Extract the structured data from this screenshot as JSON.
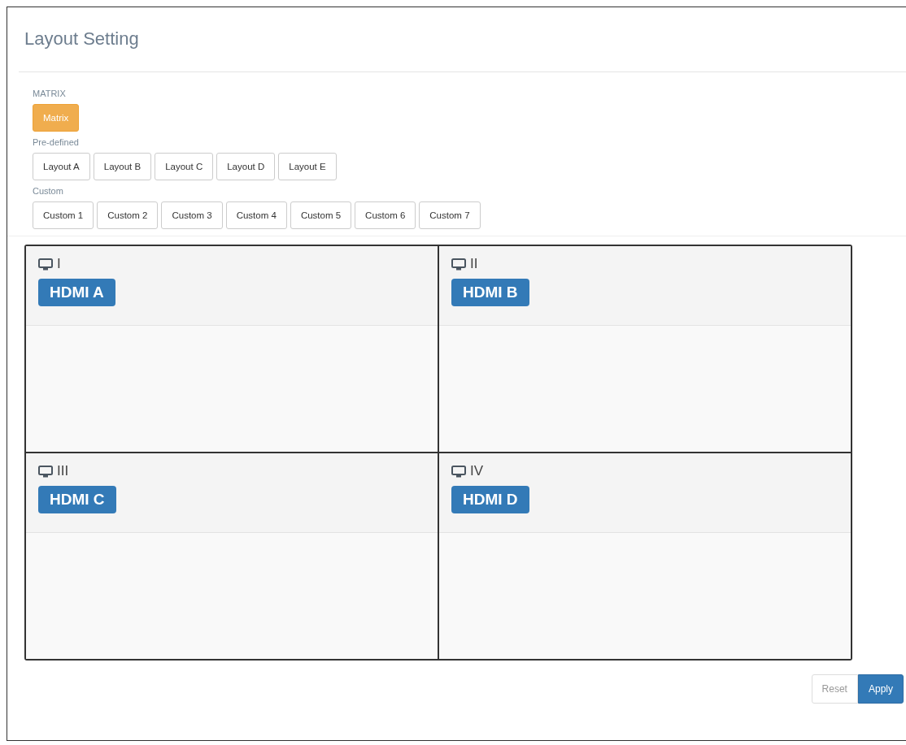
{
  "title": "Layout Setting",
  "groups": [
    {
      "label": "MATRIX",
      "buttons": [
        {
          "label": "Matrix",
          "selected": true
        }
      ]
    },
    {
      "label": "Pre-defined",
      "buttons": [
        {
          "label": "Layout A",
          "selected": false
        },
        {
          "label": "Layout B",
          "selected": false
        },
        {
          "label": "Layout C",
          "selected": false
        },
        {
          "label": "Layout D",
          "selected": false
        },
        {
          "label": "Layout E",
          "selected": false
        }
      ]
    },
    {
      "label": "Custom",
      "buttons": [
        {
          "label": "Custom 1",
          "selected": false
        },
        {
          "label": "Custom 2",
          "selected": false
        },
        {
          "label": "Custom 3",
          "selected": false
        },
        {
          "label": "Custom 4",
          "selected": false
        },
        {
          "label": "Custom 5",
          "selected": false
        },
        {
          "label": "Custom 6",
          "selected": false
        },
        {
          "label": "Custom 7",
          "selected": false
        }
      ]
    }
  ],
  "windows": [
    {
      "name": "I",
      "source": "HDMI A"
    },
    {
      "name": "II",
      "source": "HDMI B"
    },
    {
      "name": "III",
      "source": "HDMI C"
    },
    {
      "name": "IV",
      "source": "HDMI D"
    }
  ],
  "actions": [
    {
      "label": "Reset",
      "kind": "default"
    },
    {
      "label": "Apply",
      "kind": "primary"
    }
  ]
}
